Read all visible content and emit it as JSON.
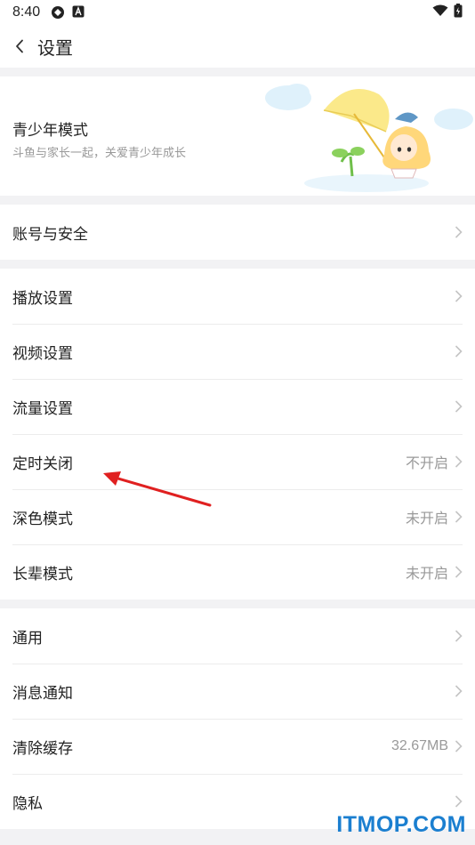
{
  "status_bar": {
    "time": "8:40"
  },
  "nav": {
    "title": "设置"
  },
  "teen_mode": {
    "title": "青少年模式",
    "subtitle": "斗鱼与家长一起，关爱青少年成长"
  },
  "groups": [
    {
      "rows": [
        {
          "label": "账号与安全",
          "value": ""
        }
      ]
    },
    {
      "rows": [
        {
          "label": "播放设置",
          "value": ""
        },
        {
          "label": "视频设置",
          "value": ""
        },
        {
          "label": "流量设置",
          "value": ""
        },
        {
          "label": "定时关闭",
          "value": "不开启"
        },
        {
          "label": "深色模式",
          "value": "未开启"
        },
        {
          "label": "长辈模式",
          "value": "未开启"
        }
      ]
    },
    {
      "rows": [
        {
          "label": "通用",
          "value": ""
        },
        {
          "label": "消息通知",
          "value": ""
        },
        {
          "label": "清除缓存",
          "value": "32.67MB"
        },
        {
          "label": "隐私",
          "value": ""
        }
      ]
    }
  ],
  "watermark": "ITMOP.COM",
  "colors": {
    "annotation_arrow": "#e02020",
    "watermark": "#1b7fd0",
    "chevron": "#c4c4c4"
  }
}
